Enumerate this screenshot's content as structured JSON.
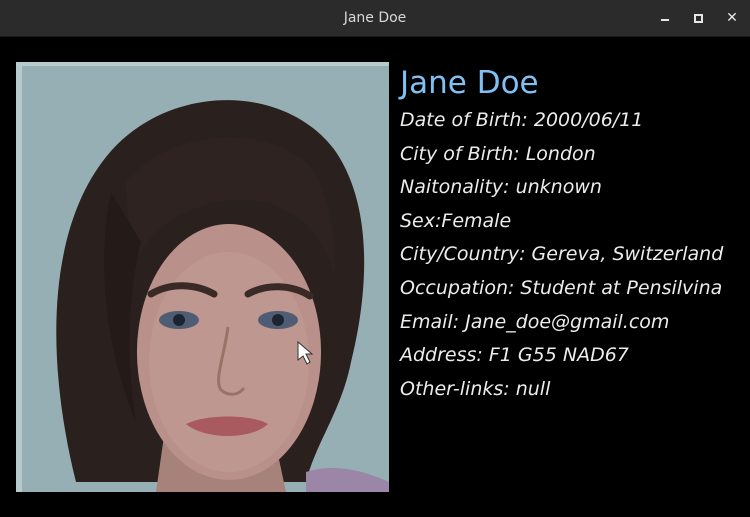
{
  "window": {
    "title": "Jane Doe",
    "buttons": {
      "minimize": "minimize-icon",
      "maximize": "maximize-icon",
      "close": "close-icon"
    }
  },
  "profile": {
    "name": "Jane Doe",
    "fields": [
      "Date of Birth: 2000/06/11",
      "City of Birth: London",
      "Naitonality: unknown",
      "Sex:Female",
      "City/Country: Gereva, Switzerland",
      "Occupation: Student at Pensilvina",
      "Email: Jane_doe@gmail.com",
      "Address: F1 G55 NAD67",
      "Other-links: null"
    ]
  },
  "colors": {
    "background": "#000000",
    "titlebar": "#2b2b2b",
    "name": "#80c1f5",
    "text": "#ececec"
  }
}
